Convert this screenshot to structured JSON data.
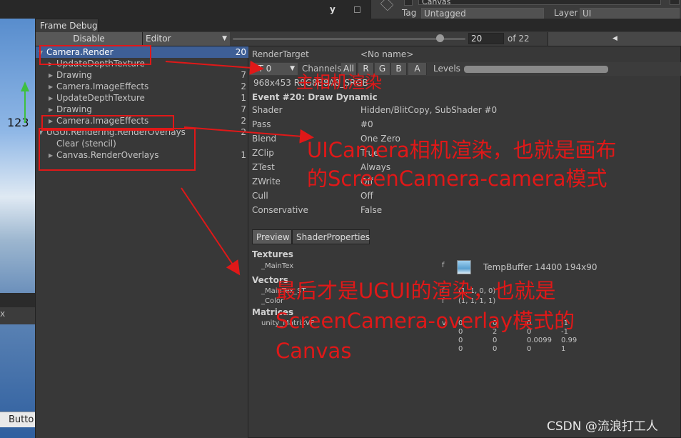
{
  "scene": {
    "label": "123",
    "button": "Butto",
    "x_glyph": "x"
  },
  "top": {
    "axis_label": "y",
    "tag_label": "Tag",
    "tag_value": "Untagged",
    "layer_label": "Layer",
    "layer_value": "UI",
    "name_value": "Canvas"
  },
  "window": {
    "title": "Frame Debug"
  },
  "toolbar": {
    "disable": "Disable",
    "editor": "Editor",
    "frame": "20",
    "of_total": "of 22"
  },
  "tree": [
    {
      "label": "Camera.Render",
      "count": "20",
      "depth": 0,
      "expanded": true,
      "selected": true
    },
    {
      "label": "UpdateDepthTexture",
      "count": "",
      "depth": 1,
      "expanded": false
    },
    {
      "label": "Drawing",
      "count": "7",
      "depth": 1,
      "expanded": false
    },
    {
      "label": "Camera.ImageEffects",
      "count": "2",
      "depth": 1,
      "expanded": false
    },
    {
      "label": "UpdateDepthTexture",
      "count": "1",
      "depth": 1,
      "expanded": false
    },
    {
      "label": "Drawing",
      "count": "7",
      "depth": 1,
      "expanded": false
    },
    {
      "label": "Camera.ImageEffects",
      "count": "2",
      "depth": 1,
      "expanded": false
    },
    {
      "label": "UGUI.Rendering.RenderOverlays",
      "count": "2",
      "depth": 0,
      "expanded": true
    },
    {
      "label": "Clear (stencil)",
      "count": "",
      "depth": 1,
      "leaf": true
    },
    {
      "label": "Canvas.RenderOverlays",
      "count": "1",
      "depth": 1,
      "expanded": false
    }
  ],
  "detail": {
    "render_target_label": "RenderTarget",
    "render_target_value": "<No name>",
    "rt_select": "RT 0",
    "channels_label": "Channels",
    "channels": [
      "All",
      "R",
      "G",
      "B",
      "A"
    ],
    "levels_label": "Levels",
    "resolution": "968x453 R8G8B8A8_SRGB",
    "event": "Event #20: Draw Dynamic",
    "props": [
      {
        "name": "Shader",
        "value": "Hidden/BlitCopy, SubShader #0"
      },
      {
        "name": "Pass",
        "value": "#0"
      },
      {
        "name": "Blend",
        "value": "One Zero"
      },
      {
        "name": "ZClip",
        "value": "True"
      },
      {
        "name": "ZTest",
        "value": "Always"
      },
      {
        "name": "ZWrite",
        "value": "Off"
      },
      {
        "name": "Cull",
        "value": "Off"
      },
      {
        "name": "Conservative",
        "value": "False"
      }
    ],
    "tabs": [
      "Preview",
      "ShaderProperties"
    ],
    "textures_label": "Textures",
    "maintex": "_MainTex",
    "maintex_flag": "f",
    "maintex_value": "TempBuffer 14400 194x90",
    "vectors_label": "Vectors",
    "maintex_st": "_MainTex_ST",
    "maintex_st_flag": "f",
    "maintex_st_value": "(1, 1, 0, 0)",
    "color": "_Color",
    "color_flag": "f",
    "color_value": "(1, 1, 1, 1)",
    "matrices_label": "Matrices",
    "matrix_name": "unity_MatrixVP",
    "matrix_flag": "v",
    "matrix_rows": [
      [
        "0",
        "0",
        "0",
        "-1"
      ],
      [
        "0",
        "2",
        "0",
        "-1"
      ],
      [
        "0",
        "0",
        "0.0099",
        "0.99"
      ],
      [
        "0",
        "0",
        "0",
        "1"
      ]
    ]
  },
  "annotations": {
    "note1": "主相机渲染",
    "note2_line1": "UICamera相机渲染，也就是画布",
    "note2_line2": "的ScreenCamera-camera模式",
    "note3_line1": "最后才是UGUI的渲染，也就是",
    "note3_line2": "ScreenCamera-overlay模式的",
    "note3_line3": "Canvas",
    "color": "#e01818"
  },
  "watermark": "CSDN @流浪打工人"
}
